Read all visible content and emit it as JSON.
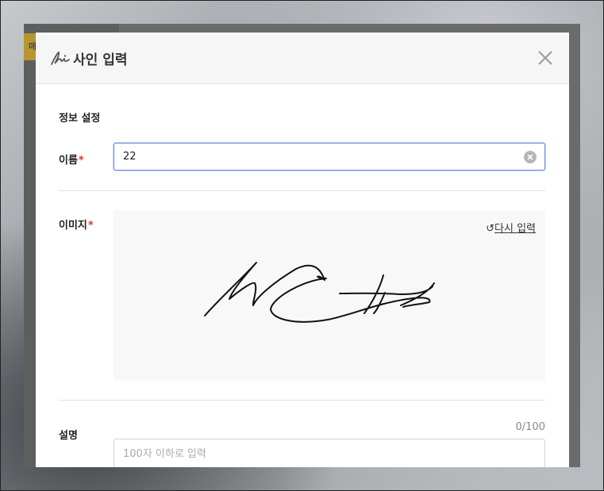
{
  "modal": {
    "title": "사인 입력",
    "section_title": "정보 설정",
    "name": {
      "label": "이름",
      "required_mark": "*",
      "value": "22"
    },
    "image": {
      "label": "이미지",
      "required_mark": "*",
      "redo_label": "다시 입력"
    },
    "description": {
      "label": "설명",
      "counter": "0/100",
      "placeholder": "100자 이하로 입력"
    }
  },
  "background": {
    "tag_text": "매"
  },
  "colors": {
    "required": "#e0352b",
    "input_focus_border": "#6a8fd9"
  },
  "icons": [
    "sign-icon",
    "close-icon",
    "clear-icon",
    "redo-icon"
  ]
}
